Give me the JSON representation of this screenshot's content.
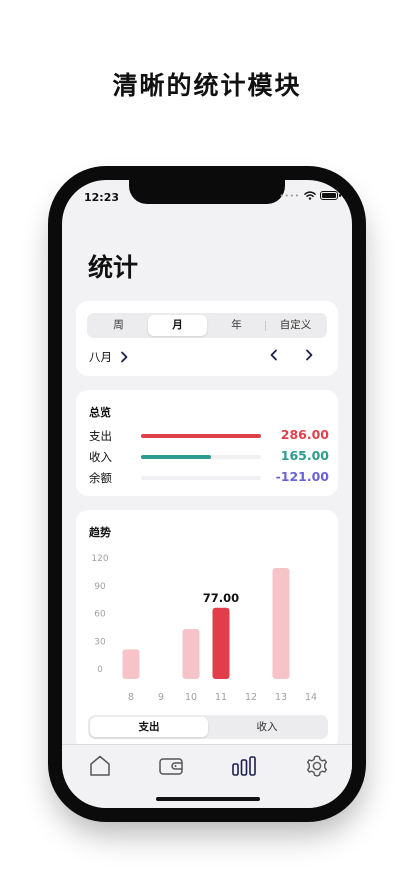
{
  "headline": "清晰的统计模块",
  "status": {
    "time": "12:23",
    "dots": "••••"
  },
  "page_title": "统计",
  "period_tabs": [
    {
      "label": "周",
      "active": false
    },
    {
      "label": "月",
      "active": true
    },
    {
      "label": "年",
      "active": false
    },
    {
      "label": "自定义",
      "active": false
    }
  ],
  "month_label": "八月",
  "summary": {
    "title": "总览",
    "rows": [
      {
        "label": "支出",
        "value": "286.00",
        "color": "#e0404c",
        "fill": 1.0
      },
      {
        "label": "收入",
        "value": "165.00",
        "color": "#2a9d8f",
        "fill": 0.58
      },
      {
        "label": "余额",
        "value": "-121.00",
        "color": "#6a62d8",
        "fill": 0.0
      }
    ]
  },
  "chart_data": {
    "type": "bar",
    "title": "趋势",
    "categories": [
      "8",
      "9",
      "10",
      "11",
      "12",
      "13",
      "14"
    ],
    "values": [
      32,
      0,
      54,
      77,
      0,
      120,
      0
    ],
    "yticks": [
      0,
      30,
      60,
      90,
      120
    ],
    "ylim": [
      0,
      130
    ],
    "highlight_index": 3,
    "highlight_label": "77.00",
    "bar_color": "#f6c4c8",
    "highlight_color": "#e23d4b"
  },
  "type_toggle": [
    {
      "label": "支出",
      "active": true
    },
    {
      "label": "收入",
      "active": false
    }
  ],
  "tabbar": [
    "home-icon",
    "wallet-icon",
    "stats-icon",
    "settings-icon"
  ],
  "colors": {
    "accent": "#1a1f4e",
    "expense": "#e0404c",
    "income": "#2a9d8f",
    "balance": "#6a62d8"
  }
}
